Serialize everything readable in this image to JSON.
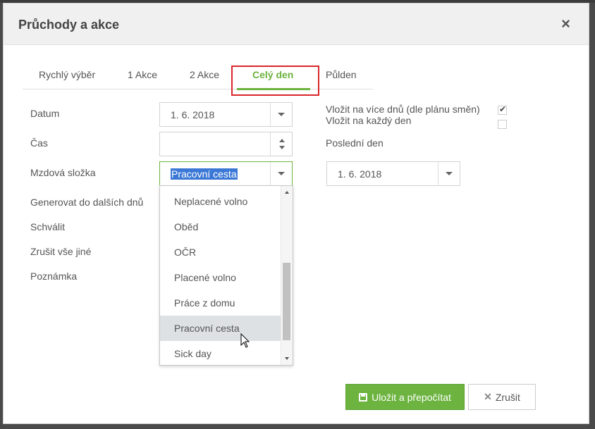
{
  "dialog": {
    "title": "Průchody a akce",
    "close_glyph": "×"
  },
  "tabs": [
    {
      "label": "Rychlý výběr"
    },
    {
      "label": "1 Akce"
    },
    {
      "label": "2 Akce"
    },
    {
      "label": "Celý den"
    },
    {
      "label": "Půlden"
    }
  ],
  "active_tab": "Celý den",
  "form": {
    "datum_label": "Datum",
    "datum_value": "1. 6. 2018",
    "cas_label": "Čas",
    "cas_value": "",
    "mzdova_label": "Mzdová složka",
    "mzdova_value": "Pracovní cesta",
    "generovat_label": "Generovat do dalších dnů",
    "schvalit_label": "Schválit",
    "zrusit_label": "Zrušit vše jiné",
    "poznamka_label": "Poznámka",
    "vice_dnu_label": "Vložit na více dnů (dle plánu směn)",
    "vice_dnu_checked": true,
    "kazdy_den_label": "Vložit na každý den",
    "kazdy_den_checked": false,
    "posledni_label": "Poslední den",
    "posledni_value": "1. 6. 2018"
  },
  "dropdown": {
    "options": [
      "Neplacené volno",
      "Oběd",
      "OČR",
      "Placené volno",
      "Práce z domu",
      "Pracovní cesta",
      "Sick day"
    ],
    "hovered": "Pracovní cesta"
  },
  "buttons": {
    "save_label": "Uložit a přepočítat",
    "cancel_label": "Zrušit"
  },
  "colors": {
    "accent": "#6cb33f",
    "highlight_border": "#d9262c",
    "selection": "#3b78d6"
  },
  "icons": {
    "save": "floppy-disk-icon",
    "cancel": "x-icon",
    "close": "close-icon"
  }
}
